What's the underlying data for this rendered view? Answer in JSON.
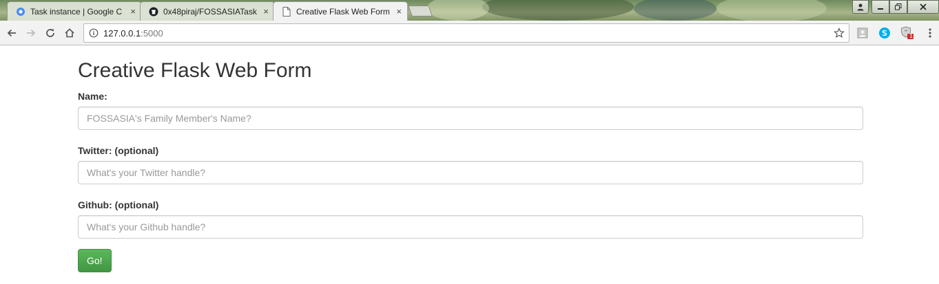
{
  "browser": {
    "tabs": [
      {
        "title": "Task instance | Google C",
        "favicon": "gear-icon",
        "active": false
      },
      {
        "title": "0x48piraj/FOSSASIATask",
        "favicon": "github-icon",
        "active": false
      },
      {
        "title": "Creative Flask Web Form",
        "favicon": "page-icon",
        "active": true
      }
    ],
    "close_glyph": "×",
    "address": {
      "host": "127.0.0.1",
      "port": ":5000"
    },
    "extension_badge": "1"
  },
  "page": {
    "heading": "Creative Flask Web Form",
    "fields": [
      {
        "label": "Name:",
        "placeholder": "FOSSASIA's Family Member's Name?",
        "value": ""
      },
      {
        "label": "Twitter: (optional)",
        "placeholder": "What's your Twitter handle?",
        "value": ""
      },
      {
        "label": "Github: (optional)",
        "placeholder": "What's your Github handle?",
        "value": ""
      }
    ],
    "submit_label": "Go!"
  },
  "colors": {
    "button_green": "#5cb85c",
    "heading_text": "#333333",
    "placeholder": "#999999"
  }
}
